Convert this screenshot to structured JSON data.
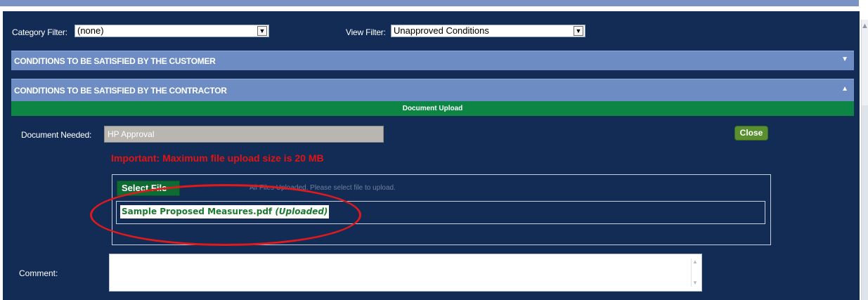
{
  "filters": {
    "category_label": "Category Filter:",
    "category_value": "(none)",
    "view_label": "View Filter:",
    "view_value": "Unapproved Conditions"
  },
  "sections": {
    "customer_title": "CONDITIONS TO BE SATISFIED BY THE CUSTOMER",
    "contractor_title": "CONDITIONS TO BE SATISFIED BY THE CONTRACTOR"
  },
  "upload": {
    "header": "Document Upload",
    "doc_needed_label": "Document Needed:",
    "doc_needed_value": "HP Approval",
    "close_label": "Close",
    "size_warning": "Important: Maximum file upload size is 20 MB",
    "select_file_label": "Select File",
    "hint": "All Files Uploaded. Please select file to upload.",
    "file_name": "Sample Proposed Measures.pdf",
    "file_status": "(Uploaded)",
    "comment_label": "Comment:"
  },
  "icons": {
    "dropdown": "chevron-down-icon",
    "collapse": "chevron-down-icon",
    "expand": "chevron-up-icon"
  },
  "colors": {
    "panel_bg": "#132c56",
    "accordion_bg": "#6e8cc4",
    "upload_header_bg": "#0c8545",
    "warning_text": "#e01414",
    "annotation_ellipse": "#e01a1a"
  }
}
